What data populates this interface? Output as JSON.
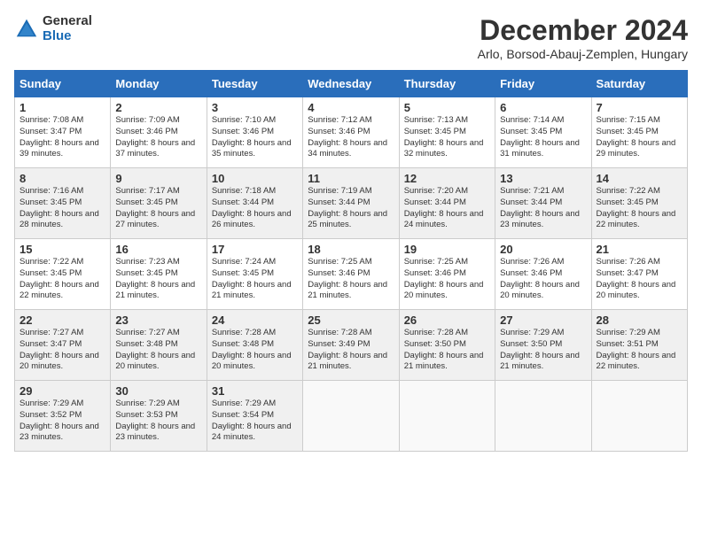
{
  "header": {
    "logo_general": "General",
    "logo_blue": "Blue",
    "month_title": "December 2024",
    "location": "Arlo, Borsod-Abauj-Zemplen, Hungary"
  },
  "weekdays": [
    "Sunday",
    "Monday",
    "Tuesday",
    "Wednesday",
    "Thursday",
    "Friday",
    "Saturday"
  ],
  "weeks": [
    [
      {
        "day": "1",
        "sunrise": "Sunrise: 7:08 AM",
        "sunset": "Sunset: 3:47 PM",
        "daylight": "Daylight: 8 hours and 39 minutes."
      },
      {
        "day": "2",
        "sunrise": "Sunrise: 7:09 AM",
        "sunset": "Sunset: 3:46 PM",
        "daylight": "Daylight: 8 hours and 37 minutes."
      },
      {
        "day": "3",
        "sunrise": "Sunrise: 7:10 AM",
        "sunset": "Sunset: 3:46 PM",
        "daylight": "Daylight: 8 hours and 35 minutes."
      },
      {
        "day": "4",
        "sunrise": "Sunrise: 7:12 AM",
        "sunset": "Sunset: 3:46 PM",
        "daylight": "Daylight: 8 hours and 34 minutes."
      },
      {
        "day": "5",
        "sunrise": "Sunrise: 7:13 AM",
        "sunset": "Sunset: 3:45 PM",
        "daylight": "Daylight: 8 hours and 32 minutes."
      },
      {
        "day": "6",
        "sunrise": "Sunrise: 7:14 AM",
        "sunset": "Sunset: 3:45 PM",
        "daylight": "Daylight: 8 hours and 31 minutes."
      },
      {
        "day": "7",
        "sunrise": "Sunrise: 7:15 AM",
        "sunset": "Sunset: 3:45 PM",
        "daylight": "Daylight: 8 hours and 29 minutes."
      }
    ],
    [
      {
        "day": "8",
        "sunrise": "Sunrise: 7:16 AM",
        "sunset": "Sunset: 3:45 PM",
        "daylight": "Daylight: 8 hours and 28 minutes."
      },
      {
        "day": "9",
        "sunrise": "Sunrise: 7:17 AM",
        "sunset": "Sunset: 3:45 PM",
        "daylight": "Daylight: 8 hours and 27 minutes."
      },
      {
        "day": "10",
        "sunrise": "Sunrise: 7:18 AM",
        "sunset": "Sunset: 3:44 PM",
        "daylight": "Daylight: 8 hours and 26 minutes."
      },
      {
        "day": "11",
        "sunrise": "Sunrise: 7:19 AM",
        "sunset": "Sunset: 3:44 PM",
        "daylight": "Daylight: 8 hours and 25 minutes."
      },
      {
        "day": "12",
        "sunrise": "Sunrise: 7:20 AM",
        "sunset": "Sunset: 3:44 PM",
        "daylight": "Daylight: 8 hours and 24 minutes."
      },
      {
        "day": "13",
        "sunrise": "Sunrise: 7:21 AM",
        "sunset": "Sunset: 3:44 PM",
        "daylight": "Daylight: 8 hours and 23 minutes."
      },
      {
        "day": "14",
        "sunrise": "Sunrise: 7:22 AM",
        "sunset": "Sunset: 3:45 PM",
        "daylight": "Daylight: 8 hours and 22 minutes."
      }
    ],
    [
      {
        "day": "15",
        "sunrise": "Sunrise: 7:22 AM",
        "sunset": "Sunset: 3:45 PM",
        "daylight": "Daylight: 8 hours and 22 minutes."
      },
      {
        "day": "16",
        "sunrise": "Sunrise: 7:23 AM",
        "sunset": "Sunset: 3:45 PM",
        "daylight": "Daylight: 8 hours and 21 minutes."
      },
      {
        "day": "17",
        "sunrise": "Sunrise: 7:24 AM",
        "sunset": "Sunset: 3:45 PM",
        "daylight": "Daylight: 8 hours and 21 minutes."
      },
      {
        "day": "18",
        "sunrise": "Sunrise: 7:25 AM",
        "sunset": "Sunset: 3:46 PM",
        "daylight": "Daylight: 8 hours and 21 minutes."
      },
      {
        "day": "19",
        "sunrise": "Sunrise: 7:25 AM",
        "sunset": "Sunset: 3:46 PM",
        "daylight": "Daylight: 8 hours and 20 minutes."
      },
      {
        "day": "20",
        "sunrise": "Sunrise: 7:26 AM",
        "sunset": "Sunset: 3:46 PM",
        "daylight": "Daylight: 8 hours and 20 minutes."
      },
      {
        "day": "21",
        "sunrise": "Sunrise: 7:26 AM",
        "sunset": "Sunset: 3:47 PM",
        "daylight": "Daylight: 8 hours and 20 minutes."
      }
    ],
    [
      {
        "day": "22",
        "sunrise": "Sunrise: 7:27 AM",
        "sunset": "Sunset: 3:47 PM",
        "daylight": "Daylight: 8 hours and 20 minutes."
      },
      {
        "day": "23",
        "sunrise": "Sunrise: 7:27 AM",
        "sunset": "Sunset: 3:48 PM",
        "daylight": "Daylight: 8 hours and 20 minutes."
      },
      {
        "day": "24",
        "sunrise": "Sunrise: 7:28 AM",
        "sunset": "Sunset: 3:48 PM",
        "daylight": "Daylight: 8 hours and 20 minutes."
      },
      {
        "day": "25",
        "sunrise": "Sunrise: 7:28 AM",
        "sunset": "Sunset: 3:49 PM",
        "daylight": "Daylight: 8 hours and 21 minutes."
      },
      {
        "day": "26",
        "sunrise": "Sunrise: 7:28 AM",
        "sunset": "Sunset: 3:50 PM",
        "daylight": "Daylight: 8 hours and 21 minutes."
      },
      {
        "day": "27",
        "sunrise": "Sunrise: 7:29 AM",
        "sunset": "Sunset: 3:50 PM",
        "daylight": "Daylight: 8 hours and 21 minutes."
      },
      {
        "day": "28",
        "sunrise": "Sunrise: 7:29 AM",
        "sunset": "Sunset: 3:51 PM",
        "daylight": "Daylight: 8 hours and 22 minutes."
      }
    ],
    [
      {
        "day": "29",
        "sunrise": "Sunrise: 7:29 AM",
        "sunset": "Sunset: 3:52 PM",
        "daylight": "Daylight: 8 hours and 23 minutes."
      },
      {
        "day": "30",
        "sunrise": "Sunrise: 7:29 AM",
        "sunset": "Sunset: 3:53 PM",
        "daylight": "Daylight: 8 hours and 23 minutes."
      },
      {
        "day": "31",
        "sunrise": "Sunrise: 7:29 AM",
        "sunset": "Sunset: 3:54 PM",
        "daylight": "Daylight: 8 hours and 24 minutes."
      },
      null,
      null,
      null,
      null
    ]
  ]
}
